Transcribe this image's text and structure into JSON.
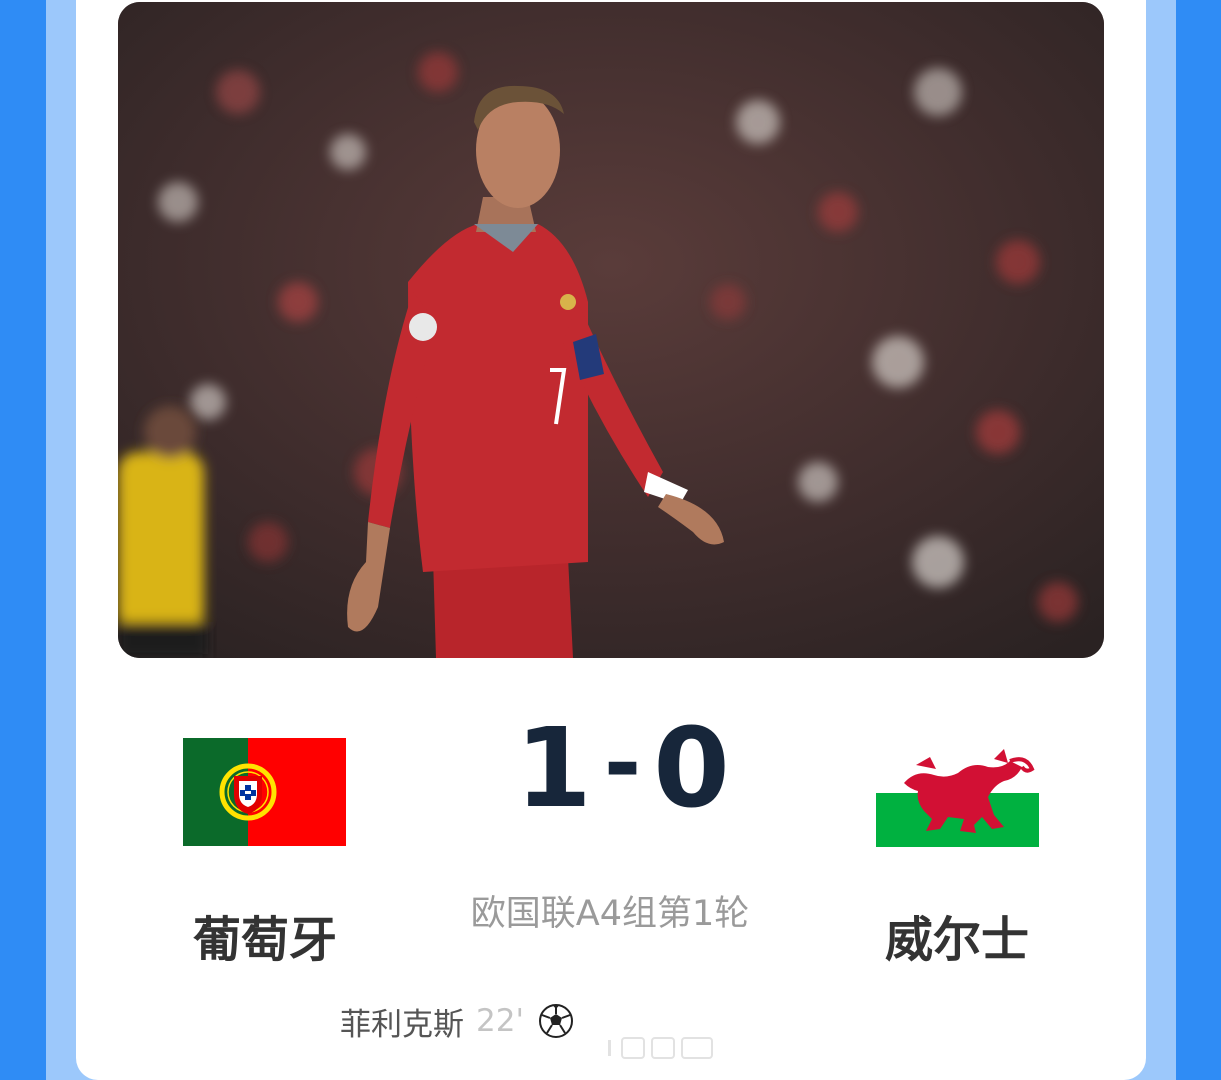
{
  "match": {
    "home_team": "葡萄牙",
    "away_team": "威尔士",
    "home_score": "1",
    "separator": "-",
    "away_score": "0",
    "competition_round": "欧国联A4组第1轮"
  },
  "scorers": [
    {
      "name": "菲利克斯",
      "minute": "22'",
      "icon": "soccer-ball-icon"
    }
  ],
  "flags": {
    "home": "portugal-flag",
    "away": "wales-flag"
  },
  "colors": {
    "background": "#2f8cf5",
    "card": "#ffffff",
    "score": "#17263a",
    "team_name": "#333333",
    "match_info": "#9a9a9a"
  }
}
